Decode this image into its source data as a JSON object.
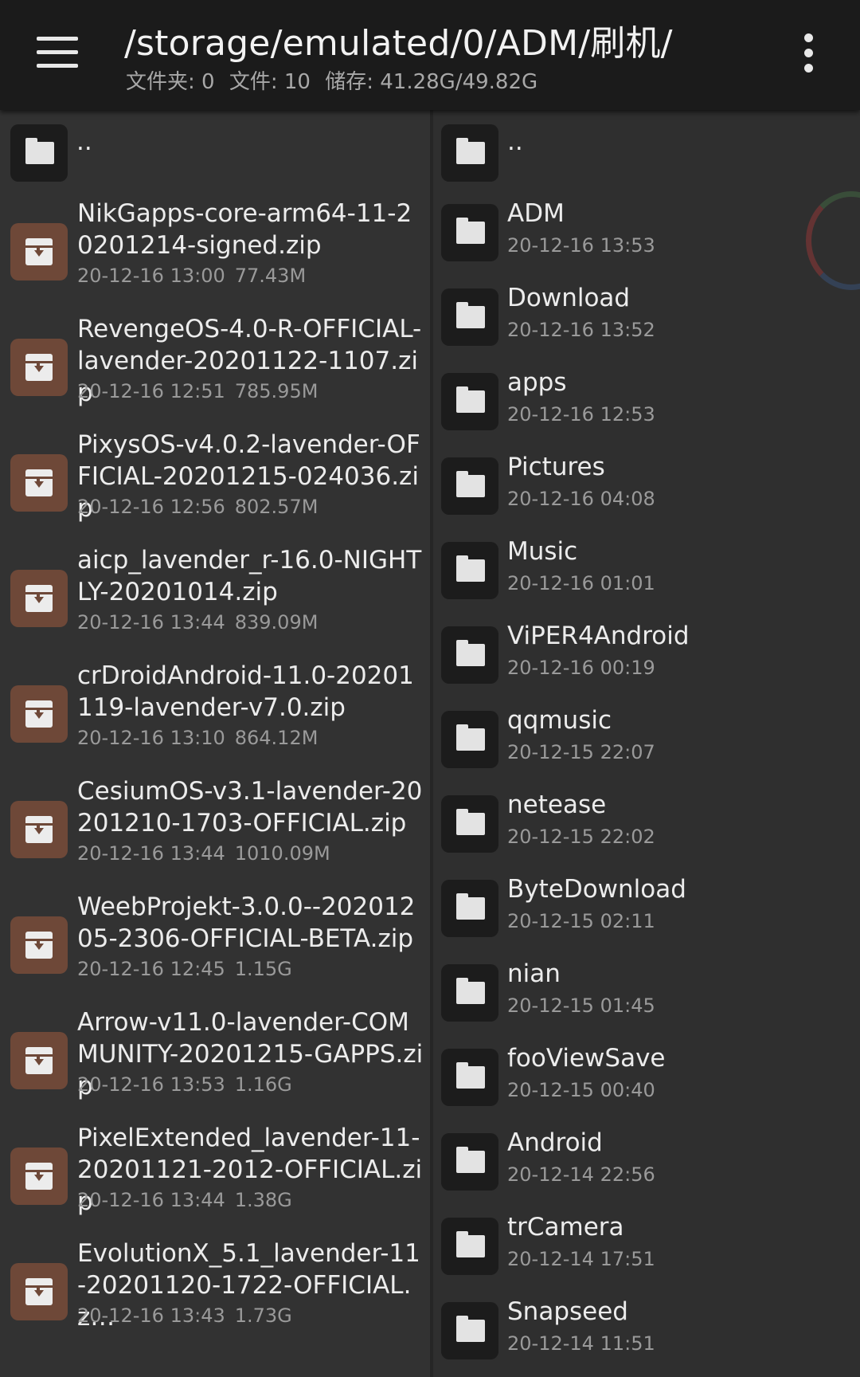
{
  "appbar": {
    "path": "/storage/emulated/0/ADM/刷机/",
    "folders_stat": "文件夹: 0",
    "files_stat": "文件: 10",
    "storage_stat": "储存: 41.28G/49.82G",
    "menu_icon": "hamburger-menu-icon",
    "more_icon": "more-vertical-icon"
  },
  "left_pane": {
    "parent": {
      "name": ".."
    },
    "files": [
      {
        "name": "NikGapps-core-arm64-11-20201214-signed.zip",
        "date": "20-12-16 13:00",
        "size": "77.43M"
      },
      {
        "name": "RevengeOS-4.0-R-OFFICIAL-lavender-20201122-1107.zip",
        "date": "20-12-16 12:51",
        "size": "785.95M"
      },
      {
        "name": "PixysOS-v4.0.2-lavender-OFFICIAL-20201215-024036.zip",
        "date": "20-12-16 12:56",
        "size": "802.57M"
      },
      {
        "name": "aicp_lavender_r-16.0-NIGHTLY-20201014.zip",
        "date": "20-12-16 13:44",
        "size": "839.09M"
      },
      {
        "name": "crDroidAndroid-11.0-20201119-lavender-v7.0.zip",
        "date": "20-12-16 13:10",
        "size": "864.12M"
      },
      {
        "name": "CesiumOS-v3.1-lavender-20201210-1703-OFFICIAL.zip",
        "date": "20-12-16 13:44",
        "size": "1010.09M"
      },
      {
        "name": "WeebProjekt-3.0.0--20201205-2306-OFFICIAL-BETA.zip",
        "date": "20-12-16 12:45",
        "size": "1.15G"
      },
      {
        "name": "Arrow-v11.0-lavender-COMMUNITY-20201215-GAPPS.zip",
        "date": "20-12-16 13:53",
        "size": "1.16G"
      },
      {
        "name": "PixelExtended_lavender-11-20201121-2012-OFFICIAL.zip",
        "date": "20-12-16 13:44",
        "size": "1.38G"
      },
      {
        "name": "EvolutionX_5.1_lavender-11-20201120-1722-OFFICIAL.z…",
        "date": "20-12-16 13:43",
        "size": "1.73G"
      }
    ]
  },
  "right_pane": {
    "parent": {
      "name": ".."
    },
    "folders": [
      {
        "name": "ADM",
        "date": "20-12-16 13:53"
      },
      {
        "name": "Download",
        "date": "20-12-16 13:52"
      },
      {
        "name": "apps",
        "date": "20-12-16 12:53"
      },
      {
        "name": "Pictures",
        "date": "20-12-16 04:08"
      },
      {
        "name": "Music",
        "date": "20-12-16 01:01"
      },
      {
        "name": "ViPER4Android",
        "date": "20-12-16 00:19"
      },
      {
        "name": "qqmusic",
        "date": "20-12-15 22:07"
      },
      {
        "name": "netease",
        "date": "20-12-15 22:02"
      },
      {
        "name": "ByteDownload",
        "date": "20-12-15 02:11"
      },
      {
        "name": "nian",
        "date": "20-12-15 01:45"
      },
      {
        "name": "fooViewSave",
        "date": "20-12-15 00:40"
      },
      {
        "name": "Android",
        "date": "20-12-14 22:56"
      },
      {
        "name": "trCamera",
        "date": "20-12-14 17:51"
      },
      {
        "name": "Snapseed",
        "date": "20-12-14 11:51"
      }
    ]
  },
  "colors": {
    "appbar": "#1b1b1b",
    "background": "#2e2e2e",
    "zip_icon_bg": "#6e4838",
    "folder_icon_bg": "#1c1c1c"
  }
}
